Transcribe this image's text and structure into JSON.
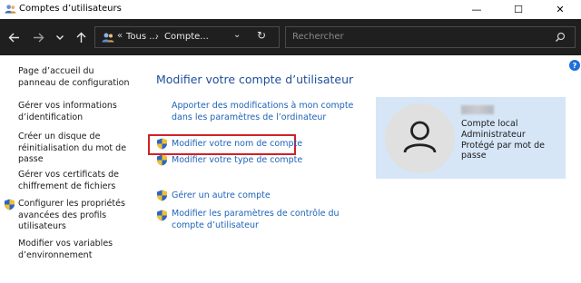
{
  "window": {
    "title": "Comptes d’utilisateurs",
    "min_glyph": "—",
    "max_glyph": "☐",
    "close_glyph": "✕"
  },
  "navbar": {
    "back_icon": "arrow-left-icon",
    "forward_icon": "arrow-right-icon",
    "recent_icon": "chevron-down-icon",
    "up_icon": "arrow-up-icon",
    "breadcrumb_overflow": "«",
    "breadcrumb_1": "Tous ...",
    "breadcrumb_sep": "›",
    "breadcrumb_2": "Compte...",
    "dropdown_glyph": "⌄",
    "refresh_glyph": "↻"
  },
  "search": {
    "placeholder": "Rechercher"
  },
  "help_label": "?",
  "sidebar": {
    "items": [
      {
        "label": "Page d’accueil du panneau de configuration"
      },
      {
        "label": "Gérer vos informations d’identification"
      },
      {
        "label": "Créer un disque de réinitialisation du mot de passe"
      },
      {
        "label": "Gérer vos certificats de chiffrement de fichiers"
      },
      {
        "label": "Configurer les propriétés avancées des profils utilisateurs"
      },
      {
        "label": "Modifier vos variables d’environnement"
      }
    ]
  },
  "main": {
    "title": "Modifier votre compte d’utilisateur",
    "links": [
      {
        "label": "Apporter des modifications à mon compte dans les paramètres de l’ordinateur"
      },
      {
        "label": "Modifier votre nom de compte"
      },
      {
        "label": "Modifier votre type de compte"
      },
      {
        "label": "Gérer un autre compte"
      },
      {
        "label": "Modifier les paramètres de contrôle du compte d’utilisateur"
      }
    ]
  },
  "account": {
    "type": "Compte local",
    "role": "Administrateur",
    "protection": "Protégé par mot de passe"
  },
  "colors": {
    "accent": "#1e63b8",
    "title": "#1f4e9c",
    "highlight": "#d32027",
    "panel": "#d6e6f7",
    "navbar": "#1f1f1f"
  }
}
